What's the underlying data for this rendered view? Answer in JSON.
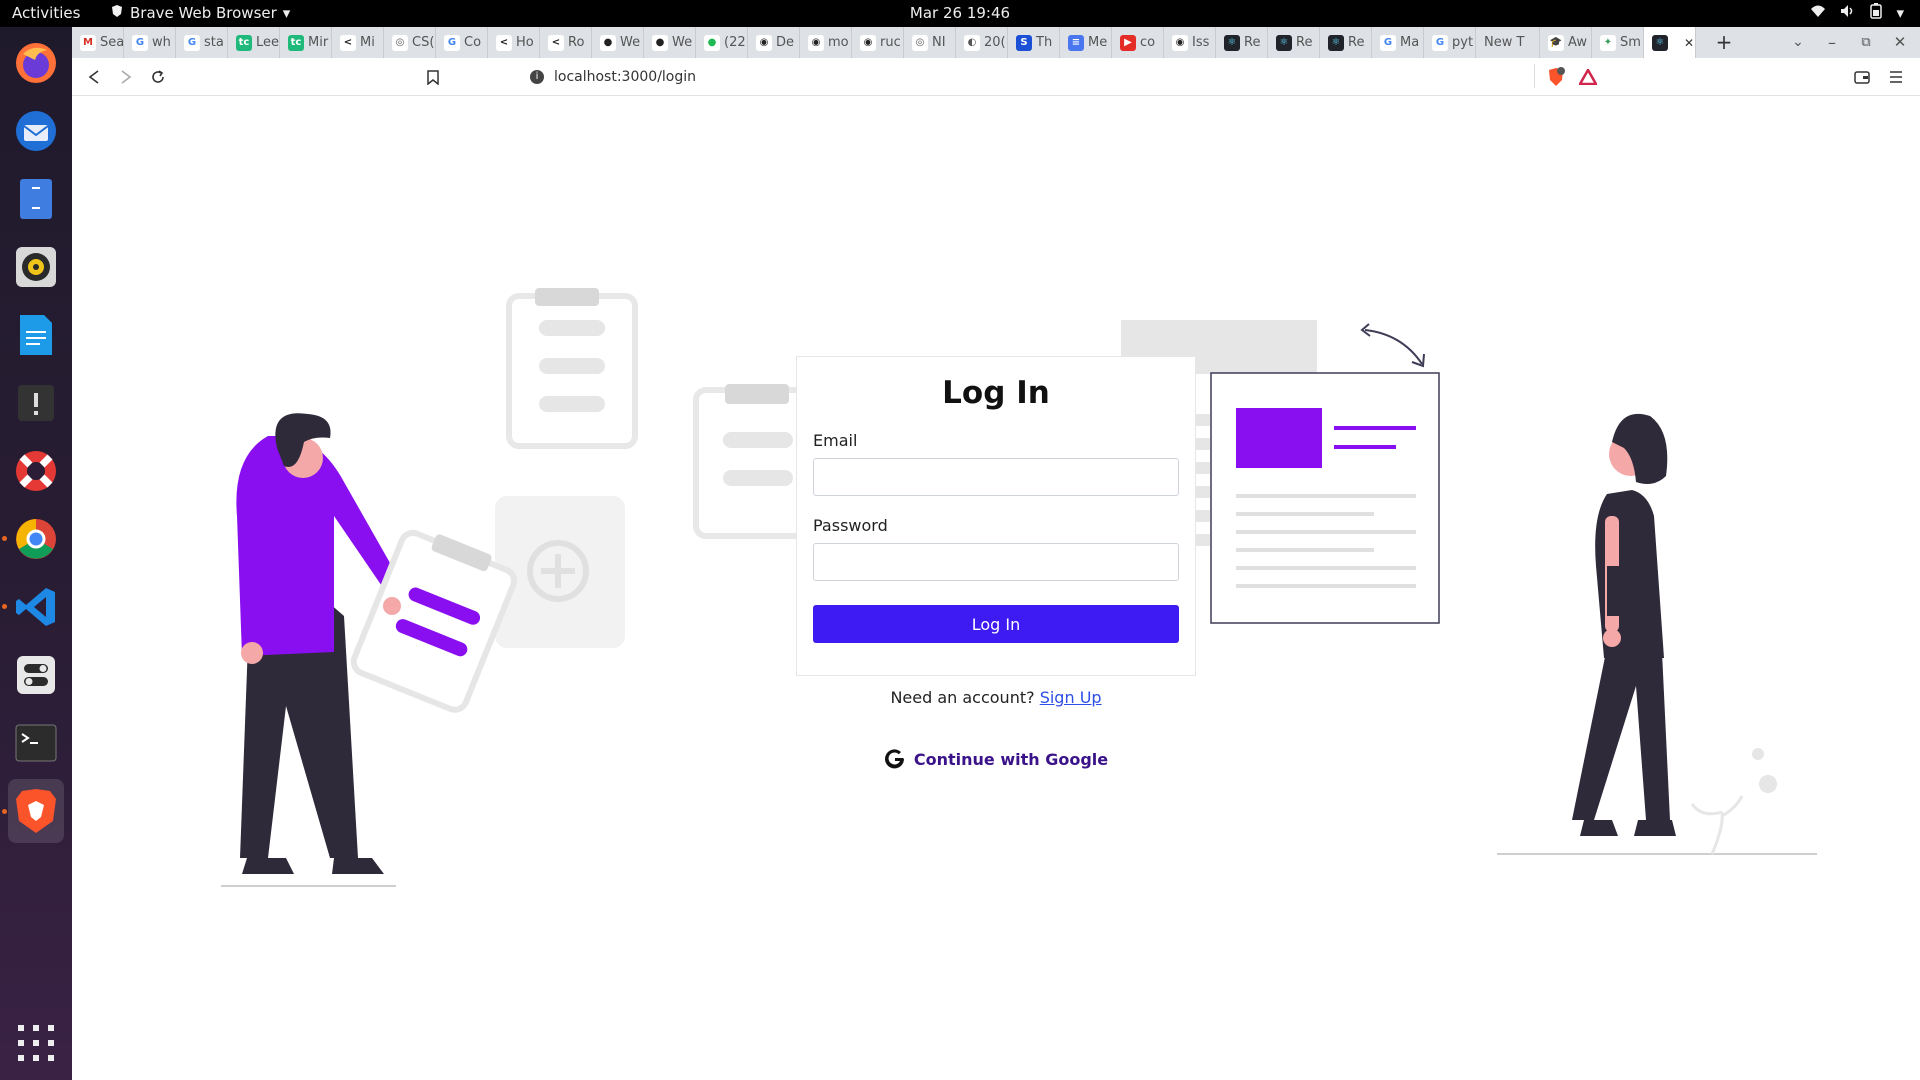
{
  "os": {
    "activities": "Activities",
    "app_name": "Brave Web Browser",
    "clock": "Mar 26  19:46"
  },
  "browser": {
    "tabs": [
      {
        "label": "Sea",
        "fav": "M",
        "color": "#ffffff",
        "fg": "#d93025"
      },
      {
        "label": "wh",
        "fav": "G",
        "color": "#ffffff",
        "fg": "#4285f4"
      },
      {
        "label": "sta",
        "fav": "G",
        "color": "#ffffff",
        "fg": "#4285f4"
      },
      {
        "label": "Lee",
        "fav": "tc",
        "color": "#1fb97b",
        "fg": "#ffffff"
      },
      {
        "label": "Mir",
        "fav": "tc",
        "color": "#1fb97b",
        "fg": "#ffffff"
      },
      {
        "label": "Mi",
        "fav": "<",
        "color": "#ffffff",
        "fg": "#222"
      },
      {
        "label": "CS(",
        "fav": "◎",
        "color": "#ffffff",
        "fg": "#555"
      },
      {
        "label": "Co",
        "fav": "G",
        "color": "#ffffff",
        "fg": "#4285f4"
      },
      {
        "label": "Ho",
        "fav": "<",
        "color": "#ffffff",
        "fg": "#222"
      },
      {
        "label": "Ro",
        "fav": "<",
        "color": "#ffffff",
        "fg": "#222"
      },
      {
        "label": "We",
        "fav": "●",
        "color": "#ffffff",
        "fg": "#222"
      },
      {
        "label": "We",
        "fav": "●",
        "color": "#ffffff",
        "fg": "#222"
      },
      {
        "label": "(22",
        "fav": "●",
        "color": "#ffffff",
        "fg": "#1db954"
      },
      {
        "label": "De",
        "fav": "◉",
        "color": "#ffffff",
        "fg": "#222"
      },
      {
        "label": "mo",
        "fav": "◉",
        "color": "#ffffff",
        "fg": "#222"
      },
      {
        "label": "ruc",
        "fav": "◉",
        "color": "#ffffff",
        "fg": "#222"
      },
      {
        "label": "NI",
        "fav": "◎",
        "color": "#ffffff",
        "fg": "#555"
      },
      {
        "label": "20(",
        "fav": "◐",
        "color": "#ffffff",
        "fg": "#555"
      },
      {
        "label": "Th",
        "fav": "S",
        "color": "#1a4fd6",
        "fg": "#ffffff"
      },
      {
        "label": "Me",
        "fav": "≡",
        "color": "#4a76f0",
        "fg": "#ffffff"
      },
      {
        "label": "co",
        "fav": "▶",
        "color": "#e52d27",
        "fg": "#ffffff"
      },
      {
        "label": "Iss",
        "fav": "◉",
        "color": "#ffffff",
        "fg": "#222"
      },
      {
        "label": "Re",
        "fav": "⚛",
        "color": "#20232a",
        "fg": "#61dafb"
      },
      {
        "label": "Re",
        "fav": "⚛",
        "color": "#20232a",
        "fg": "#61dafb"
      },
      {
        "label": "Re",
        "fav": "⚛",
        "color": "#20232a",
        "fg": "#61dafb"
      },
      {
        "label": "Ma",
        "fav": "G",
        "color": "#ffffff",
        "fg": "#4285f4"
      },
      {
        "label": "pyt",
        "fav": "G",
        "color": "#ffffff",
        "fg": "#4285f4"
      },
      {
        "label": "New T",
        "fav": "",
        "color": "#dee1e6",
        "fg": "#555"
      },
      {
        "label": "Aw",
        "fav": "🎓",
        "color": "#ffffff",
        "fg": "#222"
      },
      {
        "label": "Sm",
        "fav": "✦",
        "color": "#ffffff",
        "fg": "#3a9d5d"
      },
      {
        "label": "",
        "fav": "⚛",
        "color": "#20232a",
        "fg": "#61dafb"
      }
    ],
    "url": "localhost:3000/login"
  },
  "login": {
    "title": "Log In",
    "email_label": "Email",
    "email_value": "",
    "password_label": "Password",
    "password_value": "",
    "submit_label": "Log In",
    "signup_prompt": "Need an account?",
    "signup_link": "Sign Up",
    "google_label": "Continue with Google"
  },
  "theme": {
    "primary": "#3e1bf2",
    "accent": "#8a0ff0",
    "figure_dark": "#2f2a3a"
  }
}
